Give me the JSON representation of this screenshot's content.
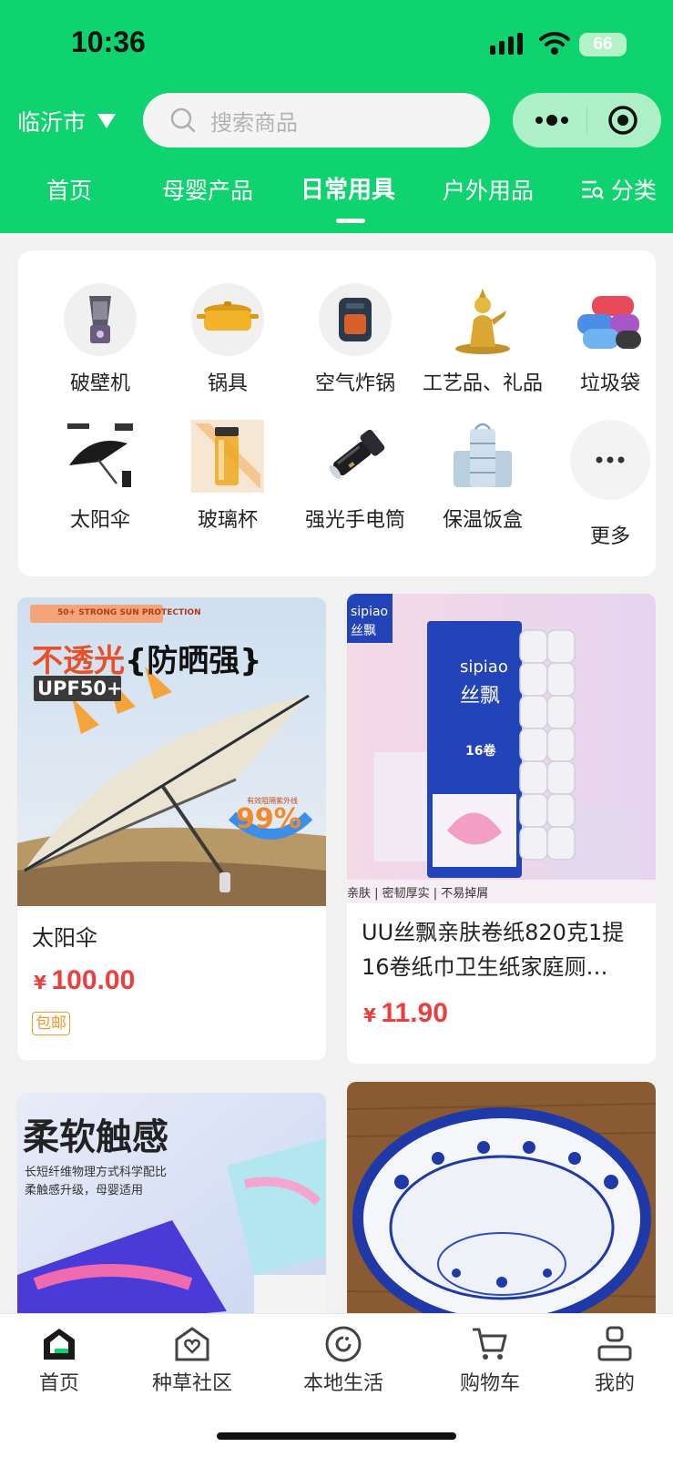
{
  "status_bar": {
    "time": "10:36",
    "battery": "66"
  },
  "header": {
    "city": "临沂市",
    "search_placeholder": "搜索商品",
    "tabs": [
      "首页",
      "母婴产品",
      "日常用具",
      "户外用品"
    ],
    "active_tab_index": 2,
    "category_label": "分类"
  },
  "categories": [
    {
      "label": "破壁机",
      "icon": "blender"
    },
    {
      "label": "锅具",
      "icon": "pot"
    },
    {
      "label": "空气炸锅",
      "icon": "air-fryer"
    },
    {
      "label": "工艺品、礼品",
      "icon": "gold-statue"
    },
    {
      "label": "垃圾袋",
      "icon": "trash-bags"
    },
    {
      "label": "太阳伞",
      "icon": "umbrella"
    },
    {
      "label": "玻璃杯",
      "icon": "glass-cup"
    },
    {
      "label": "强光手电筒",
      "icon": "flashlight"
    },
    {
      "label": "保温饭盒",
      "icon": "lunch-box"
    },
    {
      "label": "更多",
      "icon": "more-dots"
    }
  ],
  "products": [
    {
      "title": "太阳伞",
      "currency": "¥",
      "price": "100.00",
      "badge": "包邮",
      "image_text": {
        "top_tag": "50+ STRONG SUN PROTECTION",
        "headline_a": "不透光",
        "headline_b": "{防晒强}",
        "upf": "UPF50+",
        "percent_note": "有效阻隔紫外线",
        "percent": "99%"
      }
    },
    {
      "title": "UU丝飘亲肤卷纸820克1提16卷纸巾卫生纸家庭厕…",
      "currency": "¥",
      "price": "11.90",
      "image_text": {
        "brand": "sipiao",
        "brand_cn": "丝飘",
        "roll_count": "16卷",
        "footer": "亲肤 | 密韧厚实 | 不易掉屑"
      }
    },
    {
      "title": "",
      "image_text": {
        "headline": "柔软触感",
        "line1": "长短纤维物理方式科学配比",
        "line2": "柔触感升级，母婴适用"
      }
    },
    {
      "title": ""
    }
  ],
  "bottom_nav": [
    {
      "label": "首页",
      "icon": "home-icon"
    },
    {
      "label": "种草社区",
      "icon": "community-heart-icon"
    },
    {
      "label": "本地生活",
      "icon": "local-life-icon"
    },
    {
      "label": "购物车",
      "icon": "cart-icon"
    },
    {
      "label": "我的",
      "icon": "profile-icon"
    }
  ],
  "colors": {
    "brand_green": "#0fd36f",
    "price_red": "#ec3e3e",
    "badge_orange": "#f29a2e"
  }
}
